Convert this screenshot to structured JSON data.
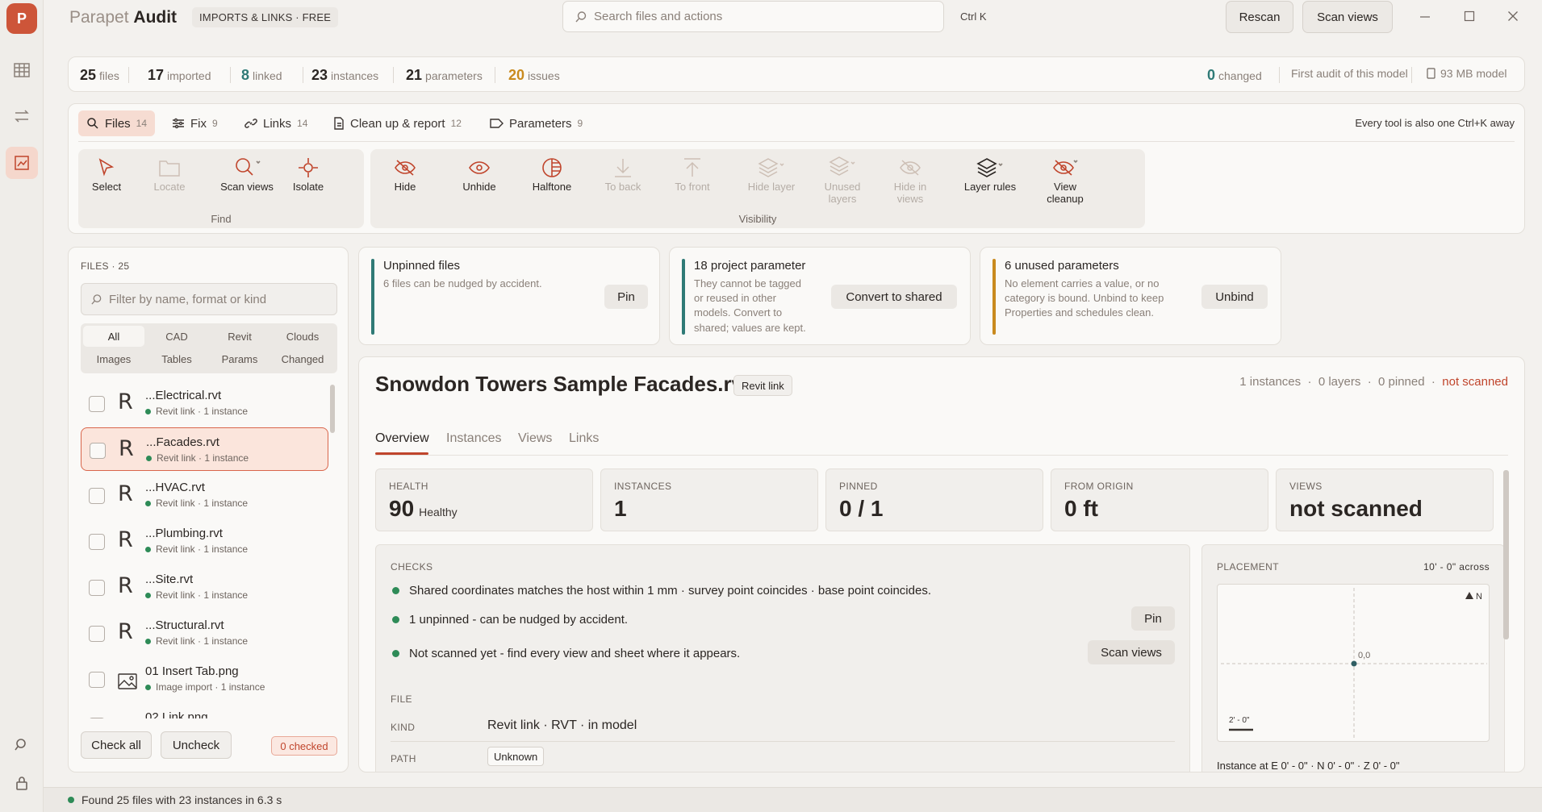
{
  "app": {
    "logo": "P",
    "name_light": "Parapet",
    "name_bold": "Audit",
    "badge": "IMPORTS & LINKS · FREE"
  },
  "search": {
    "placeholder": "Search files and actions",
    "shortcut": "Ctrl K"
  },
  "header_buttons": {
    "rescan": "Rescan",
    "scan_views": "Scan views"
  },
  "rail": [
    "grid-icon",
    "swap-icon",
    "chart-icon",
    "search-icon",
    "lock-icon"
  ],
  "stats": {
    "files": {
      "value": "25",
      "label": "files"
    },
    "imported": {
      "value": "17",
      "label": "imported"
    },
    "linked": {
      "value": "8",
      "label": "linked"
    },
    "instances": {
      "value": "23",
      "label": "instances"
    },
    "parameters": {
      "value": "21",
      "label": "parameters"
    },
    "issues": {
      "value": "20",
      "label": "issues"
    },
    "changed": {
      "value": "0",
      "label": "changed"
    },
    "first_audit": "First audit of this model",
    "model_size": "93 MB model"
  },
  "tabs": [
    {
      "label": "Files",
      "count": "14"
    },
    {
      "label": "Fix",
      "count": "9"
    },
    {
      "label": "Links",
      "count": "14"
    },
    {
      "label": "Clean up & report",
      "count": "12"
    },
    {
      "label": "Parameters",
      "count": "9"
    }
  ],
  "tools_hint": "Every tool is also one Ctrl+K away",
  "groups": {
    "find": "Find",
    "visibility": "Visibility"
  },
  "tools": {
    "select": "Select",
    "locate": "Locate",
    "scan_views": "Scan views",
    "isolate": "Isolate",
    "hide": "Hide",
    "unhide": "Unhide",
    "halftone": "Halftone",
    "to_back": "To back",
    "to_front": "To front",
    "hide_layer": "Hide layer",
    "unused_layers_1": "Unused",
    "unused_layers_2": "layers",
    "hide_in_views_1": "Hide in",
    "hide_in_views_2": "views",
    "layer_rules": "Layer rules",
    "view_cleanup_1": "View",
    "view_cleanup_2": "cleanup"
  },
  "files_panel": {
    "label": "FILES · 25",
    "filter_placeholder": "Filter by name, format or kind",
    "segments": [
      "All",
      "CAD",
      "Revit",
      "Clouds",
      "Images",
      "Tables",
      "Params",
      "Changed"
    ],
    "files": [
      {
        "name": "...Electrical.rvt",
        "sub": "Revit link · 1 instance",
        "type": "R"
      },
      {
        "name": "...Facades.rvt",
        "sub": "Revit link · 1 instance",
        "type": "R"
      },
      {
        "name": "...HVAC.rvt",
        "sub": "Revit link · 1 instance",
        "type": "R"
      },
      {
        "name": "...Plumbing.rvt",
        "sub": "Revit link · 1 instance",
        "type": "R"
      },
      {
        "name": "...Site.rvt",
        "sub": "Revit link · 1 instance",
        "type": "R"
      },
      {
        "name": "...Structural.rvt",
        "sub": "Revit link · 1 instance",
        "type": "R"
      },
      {
        "name": "01 Insert Tab.png",
        "sub": "Image import · 1 instance",
        "type": "image"
      },
      {
        "name": "02 Link.png",
        "sub": "",
        "type": "image"
      }
    ],
    "check_all": "Check all",
    "uncheck": "Uncheck",
    "checked": "0 checked"
  },
  "cards": [
    {
      "title": "Unpinned files",
      "desc": [
        "6 files can be nudged by accident."
      ],
      "button": "Pin",
      "color": "#2f7a76"
    },
    {
      "title": "18 project parameter",
      "desc": [
        "They cannot be tagged",
        "or reused in other",
        "models. Convert to",
        "shared; values are kept."
      ],
      "button": "Convert to shared",
      "color": "#2f7a76"
    },
    {
      "title": "6 unused parameters",
      "desc": [
        "No element carries a value, or no",
        "category is bound. Unbind to keep",
        "Properties and schedules clean."
      ],
      "button": "Unbind",
      "color": "#c98a1e"
    }
  ],
  "detail": {
    "title": "Snowdon Towers Sample Facades.rvt",
    "badge": "Revit link",
    "meta": {
      "instances": "1 instances",
      "layers": "0 layers",
      "pinned": "0 pinned",
      "scan": "not scanned"
    },
    "tabs": [
      "Overview",
      "Instances",
      "Views",
      "Links"
    ],
    "metrics": [
      {
        "label": "HEALTH",
        "value": "90",
        "sub": "Healthy"
      },
      {
        "label": "INSTANCES",
        "value": "1",
        "sub": ""
      },
      {
        "label": "PINNED",
        "value": "0 / 1",
        "sub": ""
      },
      {
        "label": "FROM ORIGIN",
        "value": "0 ft",
        "sub": ""
      },
      {
        "label": "VIEWS",
        "value": "not scanned",
        "sub": ""
      }
    ],
    "checks_label": "CHECKS",
    "checks": [
      "Shared coordinates matches the host within 1 mm · survey point coincides · base point coincides.",
      "1 unpinned - can be nudged by accident.",
      "Not scanned yet - find every view and sheet where it appears."
    ],
    "check_buttons": {
      "pin": "Pin",
      "scan_views": "Scan views"
    },
    "file_label": "FILE",
    "kind_label": "KIND",
    "kind_value": "Revit link  ·  RVT  ·  in model",
    "path_label": "PATH",
    "path_value": "Unknown",
    "placement_label": "PLACEMENT",
    "placement_across": "10' - 0\" across",
    "placement_origin": "0,0",
    "placement_north": "N",
    "placement_scale": "2' - 0\"",
    "placement_footer": "Instance at E 0' - 0\" · N 0' - 0\" · Z 0' - 0\""
  },
  "status": "Found 25 files with 23 instances in 6.3 s",
  "colors": {
    "accent": "#c0452c",
    "ok": "#2e8b57",
    "teal": "#2f7a76",
    "amber": "#c98a1e"
  }
}
